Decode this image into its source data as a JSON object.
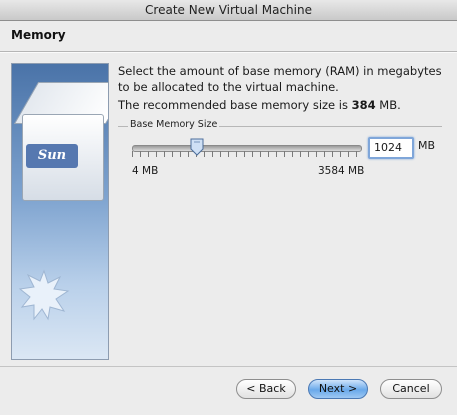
{
  "window": {
    "title": "Create New Virtual Machine"
  },
  "header": {
    "title": "Memory"
  },
  "sidebar": {
    "logo_text": "Sun"
  },
  "main": {
    "description": "Select the amount of base memory (RAM) in megabytes to be allocated to the virtual machine.",
    "recommended_prefix": "The recommended base memory size is ",
    "recommended_value": "384",
    "recommended_suffix": " MB."
  },
  "memory": {
    "group_label": "Base Memory Size",
    "value": "1024",
    "unit": "MB",
    "min_label": "4 MB",
    "max_label": "3584 MB",
    "min_mb": 4,
    "max_mb": 3584,
    "current_mb": 1024
  },
  "footer": {
    "back_label": "< Back",
    "next_label": "Next >",
    "cancel_label": "Cancel"
  }
}
